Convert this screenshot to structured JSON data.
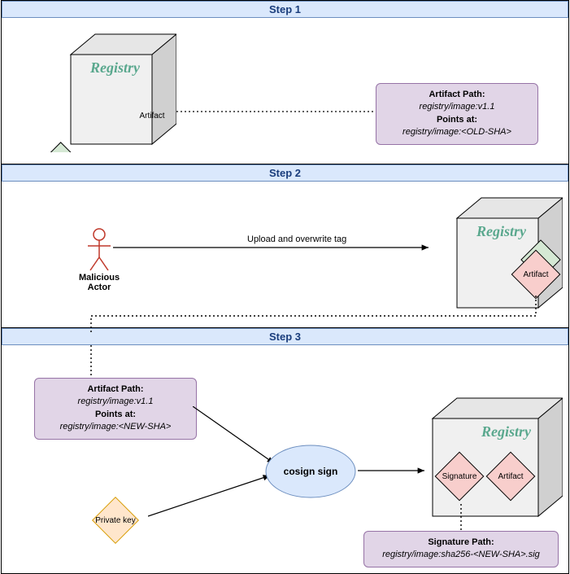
{
  "step1": {
    "header": "Step 1",
    "registry_label": "Registry",
    "artifact_label": "Artifact",
    "infobox": {
      "t1": "Artifact Path:",
      "v1": "registry/image:v1.1",
      "t2": "Points at:",
      "v2": "registry/image:<OLD-SHA>"
    }
  },
  "step2": {
    "header": "Step 2",
    "actor_label": "Malicious Actor",
    "edge_label": "Upload and overwrite tag",
    "registry_label": "Registry",
    "artifact_label": "Artifact"
  },
  "step3": {
    "header": "Step 3",
    "infobox1": {
      "t1": "Artifact Path:",
      "v1": "registry/image:v1.1",
      "t2": "Points at:",
      "v2": "registry/image:<NEW-SHA>"
    },
    "private_key": "Private key",
    "cosign": "cosign sign",
    "registry_label": "Registry",
    "signature_label": "Signature",
    "artifact_label": "Artifact",
    "infobox2": {
      "t1": "Signature Path:",
      "v1": "registry/image:sha256-<NEW-SHA>.sig"
    }
  }
}
